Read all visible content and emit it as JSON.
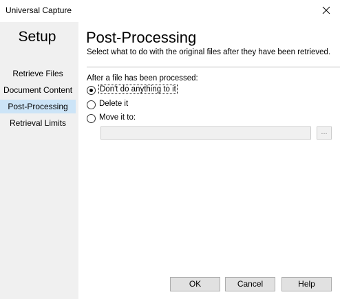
{
  "window": {
    "title": "Universal Capture"
  },
  "sidebar": {
    "heading": "Setup",
    "items": [
      {
        "label": "Retrieve Files"
      },
      {
        "label": "Document Content"
      },
      {
        "label": "Post-Processing",
        "selected": true
      },
      {
        "label": "Retrieval Limits"
      }
    ]
  },
  "main": {
    "title": "Post-Processing",
    "subtitle": "Select what to do with the original files after they have been retrieved.",
    "group_label": "After a file has been processed:",
    "options": [
      {
        "label": "Don't do anything to it",
        "checked": true
      },
      {
        "label": "Delete it",
        "checked": false
      },
      {
        "label": "Move it to:",
        "checked": false
      }
    ],
    "move_path": {
      "value": "",
      "placeholder": ""
    },
    "browse_label": "..."
  },
  "buttons": {
    "ok": "OK",
    "cancel": "Cancel",
    "help": "Help"
  },
  "colors": {
    "sidebar_bg": "#f0f0f0",
    "selected_bg": "#cce4f7",
    "button_bg": "#e1e1e1"
  }
}
